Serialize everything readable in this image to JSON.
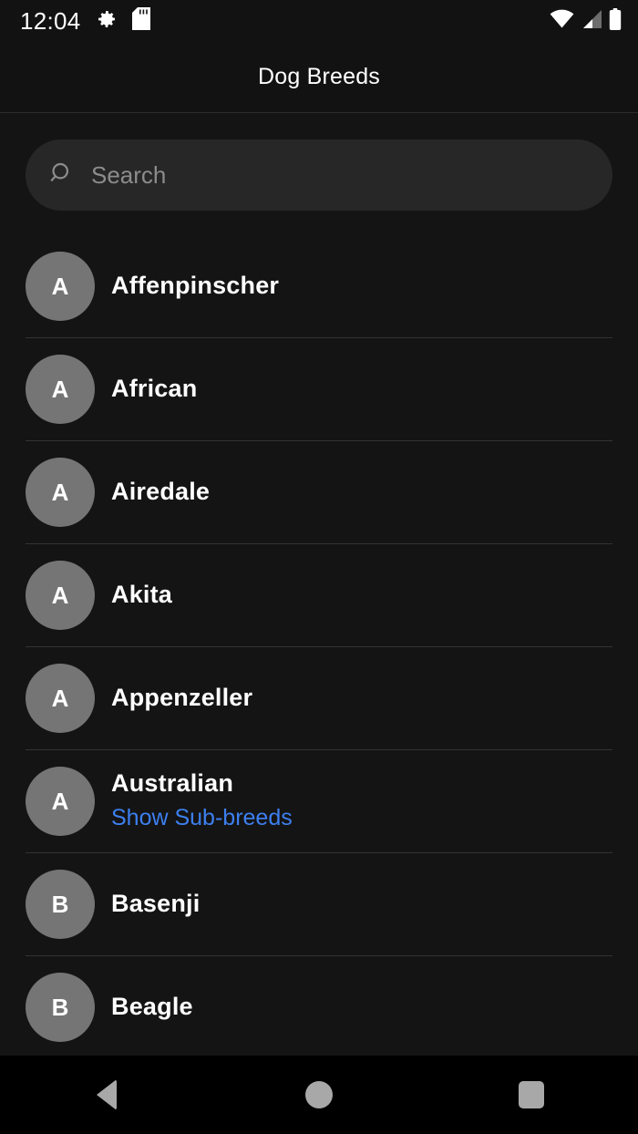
{
  "status_bar": {
    "time": "12:04",
    "left_icons": [
      "gear-icon",
      "sd-card-icon"
    ],
    "right_icons": [
      "wifi-icon",
      "cellular-signal-icon",
      "battery-icon"
    ]
  },
  "app_bar": {
    "title": "Dog Breeds"
  },
  "search": {
    "placeholder": "Search",
    "value": "",
    "icon": "search-icon"
  },
  "colors": {
    "background": "#141414",
    "app_bar": "#121212",
    "search_field": "#272727",
    "avatar": "#757575",
    "divider": "#333333",
    "link": "#3d7fef",
    "text": "#ffffff",
    "nav_icon": "#a8a8a8"
  },
  "breeds": [
    {
      "initial": "A",
      "name": "Affenpinscher"
    },
    {
      "initial": "A",
      "name": "African"
    },
    {
      "initial": "A",
      "name": "Airedale"
    },
    {
      "initial": "A",
      "name": "Akita"
    },
    {
      "initial": "A",
      "name": "Appenzeller"
    },
    {
      "initial": "A",
      "name": "Australian",
      "sub_breeds_label": "Show Sub-breeds"
    },
    {
      "initial": "B",
      "name": "Basenji"
    },
    {
      "initial": "B",
      "name": "Beagle"
    }
  ],
  "nav_bar": {
    "back": "back-icon",
    "home": "home-icon",
    "recents": "recents-icon"
  }
}
